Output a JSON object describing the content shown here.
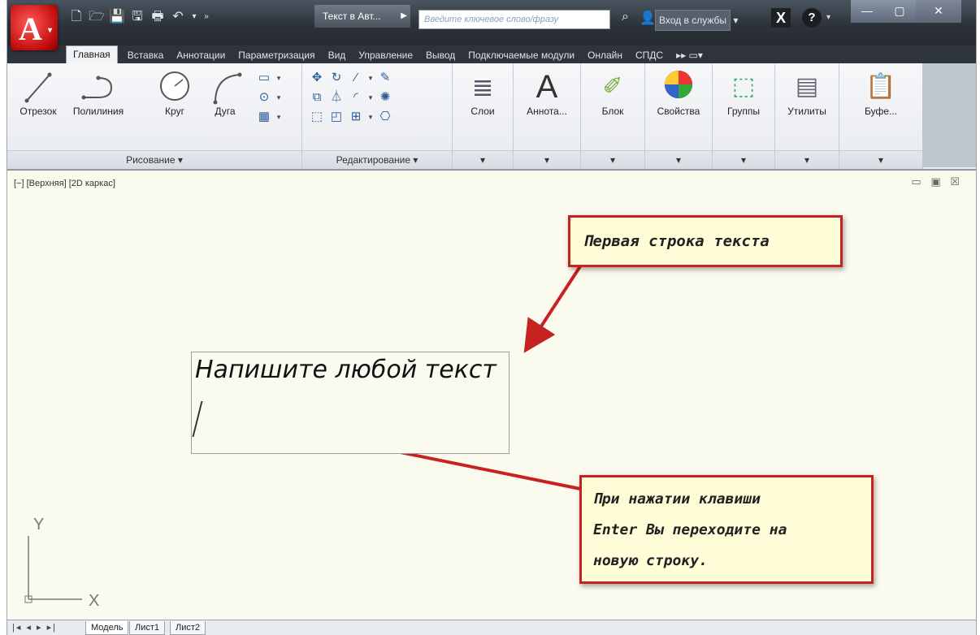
{
  "title_bar": {
    "app_icon_label": "A",
    "document_title": "Текст в Авт...",
    "search_placeholder": "Введите ключевое слово/фразу",
    "sign_in": "Вход в службы",
    "help_label": "?",
    "exchange_label": "X"
  },
  "tabs": [
    {
      "label": "Главная",
      "active": true
    },
    {
      "label": "Вставка"
    },
    {
      "label": "Аннотации"
    },
    {
      "label": "Параметризация"
    },
    {
      "label": "Вид"
    },
    {
      "label": "Управление"
    },
    {
      "label": "Вывод"
    },
    {
      "label": "Подключаемые модули"
    },
    {
      "label": "Онлайн"
    },
    {
      "label": "СПДС"
    }
  ],
  "ribbon": {
    "draw_panel": {
      "title": "Рисование ▾",
      "tools": [
        "Отрезок",
        "Полилиния",
        "Круг",
        "Дуга"
      ]
    },
    "modify_panel": {
      "title": "Редактирование ▾"
    },
    "large_buttons": [
      {
        "label": "Слои",
        "icon": "layers-icon"
      },
      {
        "label": "Аннота...",
        "icon": "annotation-icon"
      },
      {
        "label": "Блок",
        "icon": "block-icon"
      },
      {
        "label": "Свойства",
        "icon": "properties-icon"
      },
      {
        "label": "Группы",
        "icon": "groups-icon"
      },
      {
        "label": "Утилиты",
        "icon": "utilities-icon"
      },
      {
        "label": "Буфе...",
        "icon": "clipboard-icon"
      }
    ]
  },
  "viewport": {
    "label": "[−] [Верхняя] [2D каркас]",
    "text_entry_line": "Напишите любой текст"
  },
  "callouts": {
    "first": "Первая строка текста",
    "second": [
      "При нажатии клавиши",
      "Enter Вы переходите на",
      "новую строку."
    ]
  },
  "ucs": {
    "x_label": "X",
    "y_label": "Y"
  },
  "layout_tabs": [
    "Модель",
    "Лист1",
    "Лист2"
  ],
  "colors": {
    "callout_border": "#c72222",
    "callout_fill": "#fefdd8",
    "arrow": "#c72222"
  }
}
